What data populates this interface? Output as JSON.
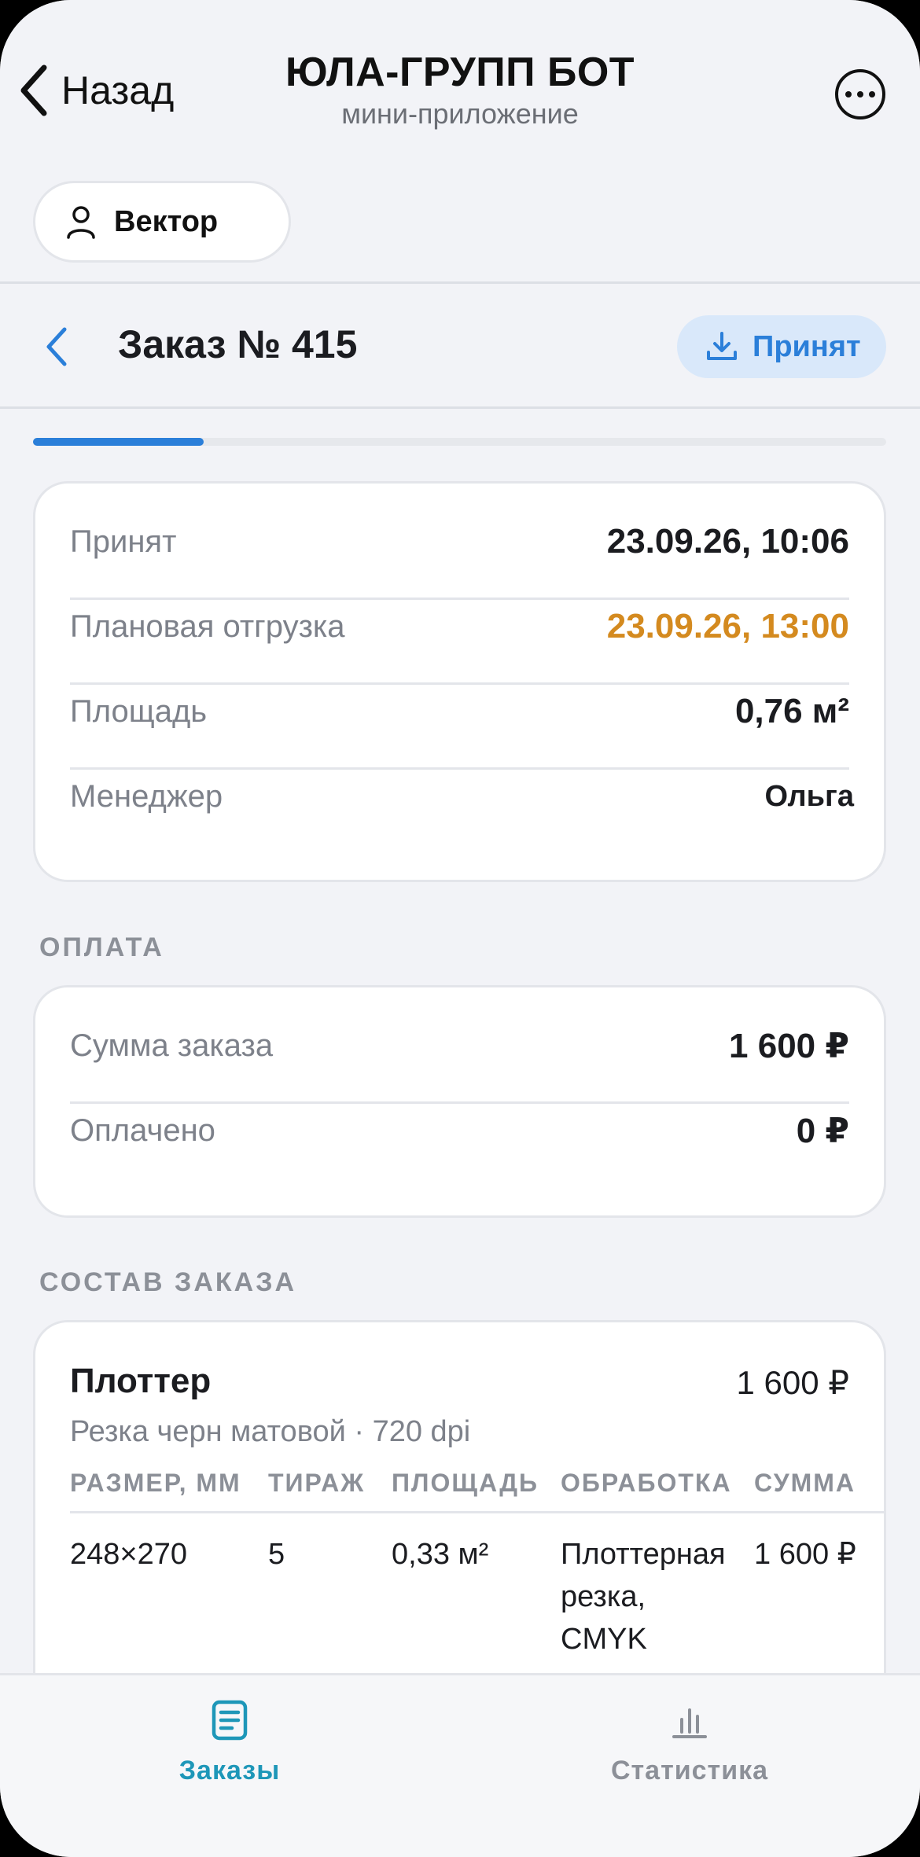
{
  "telegram": {
    "back_label": "Назад",
    "title": "ЮЛА-ГРУПП БОТ",
    "subtitle": "мини-приложение"
  },
  "user": {
    "name": "Вектор"
  },
  "order": {
    "title": "Заказ № 415",
    "status_label": "Принят",
    "progress_fraction": 0.2
  },
  "details": [
    {
      "label": "Принят",
      "value": "23.09.26, 10:06"
    },
    {
      "label": "Плановая отгрузка",
      "value": "23.09.26, 13:00"
    },
    {
      "label": "Площадь",
      "value": "0,76 м²"
    },
    {
      "label": "Менеджер",
      "value": "Ольга"
    }
  ],
  "payment": {
    "section_title": "ОПЛАТА",
    "rows": [
      {
        "label": "Сумма заказа",
        "value": "1 600 ₽"
      },
      {
        "label": "Оплачено",
        "value": "0 ₽"
      }
    ]
  },
  "composition": {
    "section_title": "СОСТАВ ЗАКАЗА",
    "item": {
      "name": "Плоттер",
      "price": "1 600 ₽",
      "description": "Резка черн матовой · 720 dpi",
      "columns": [
        "РАЗМЕР, ММ",
        "ТИРАЖ",
        "ПЛОЩАДЬ",
        "ОБРАБОТКА",
        "СУММА"
      ],
      "row": {
        "size": "248×270",
        "qty": "5",
        "area": "0,33 м²",
        "processing_1": "Плоттерная",
        "processing_2": "резка,",
        "processing_3": "CMYK",
        "sum": "1 600 ₽"
      }
    }
  },
  "tabs": [
    {
      "label": "Заказы",
      "icon": "document-icon",
      "active": true
    },
    {
      "label": "Статистика",
      "icon": "bar-chart-icon",
      "active": false
    }
  ],
  "colors": {
    "accent_blue": "#2b7fd9",
    "accent_teal": "#1e97b8",
    "shipment_orange": "#d48a1f"
  }
}
